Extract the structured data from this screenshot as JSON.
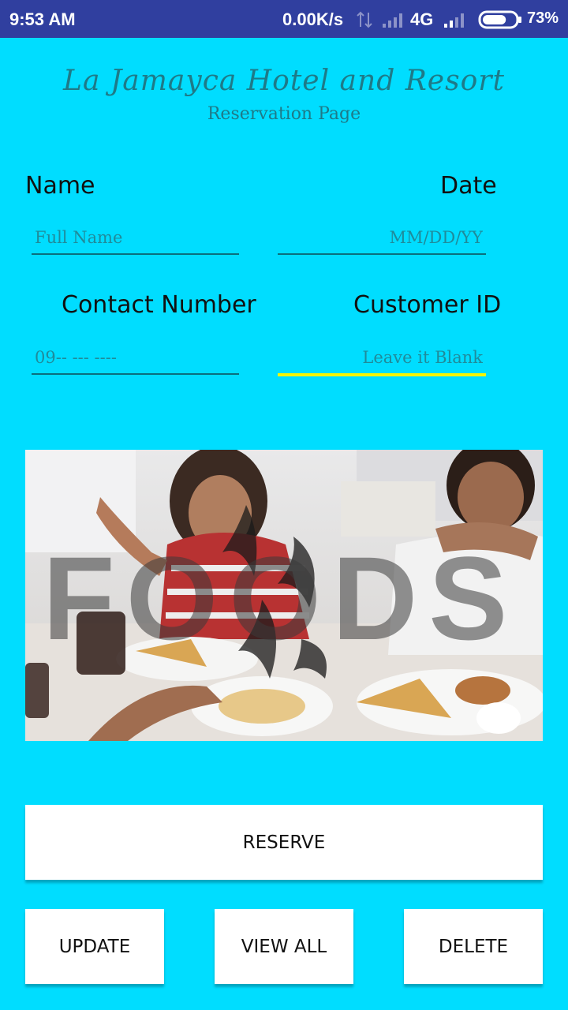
{
  "status_bar": {
    "time": "9:53 AM",
    "net_speed": "0.00K/s",
    "network_type": "4G",
    "battery_percent": "73%",
    "battery_level": 0.73
  },
  "header": {
    "title": "La Jamayca Hotel and Resort",
    "subtitle": "Reservation Page"
  },
  "form": {
    "name_label": "Name",
    "name_placeholder": "Full Name",
    "date_label": "Date",
    "date_placeholder": "MM/DD/YY",
    "contact_label": "Contact Number",
    "contact_placeholder": "09-- --- ----",
    "customer_id_label": "Customer ID",
    "customer_id_placeholder": "Leave it Blank"
  },
  "banner": {
    "overlay_text": "FOODS"
  },
  "buttons": {
    "reserve": "RESERVE",
    "update": "UPDATE",
    "view_all": "VIEW ALL",
    "delete": "DELETE"
  },
  "colors": {
    "background": "#00DDFF",
    "status_bar": "#303F9F",
    "accent_text": "#1E7A88",
    "active_underline": "#F5F500"
  }
}
